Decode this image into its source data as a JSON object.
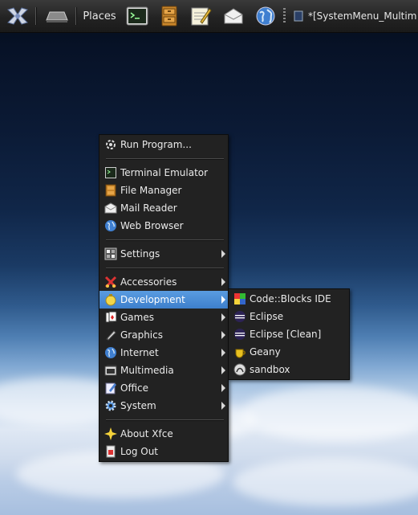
{
  "panel": {
    "places_label": "Places",
    "task_title": "*[SystemMenu_Multim",
    "launchers": [
      {
        "icon": "xfce-logo-icon"
      },
      {
        "icon": "show-desktop-icon"
      },
      {
        "icon": "terminal-icon"
      },
      {
        "icon": "file-manager-icon"
      },
      {
        "icon": "text-editor-icon"
      },
      {
        "icon": "mail-icon"
      },
      {
        "icon": "web-browser-icon"
      }
    ]
  },
  "main_menu": {
    "run_program": "Run Program...",
    "terminal": "Terminal Emulator",
    "file_manager": "File Manager",
    "mail_reader": "Mail Reader",
    "web_browser": "Web Browser",
    "settings": "Settings",
    "accessories": "Accessories",
    "development": "Development",
    "games": "Games",
    "graphics": "Graphics",
    "internet": "Internet",
    "multimedia": "Multimedia",
    "office": "Office",
    "system": "System",
    "about": "About Xfce",
    "logout": "Log Out"
  },
  "dev_submenu": {
    "items": [
      "Code::Blocks IDE",
      "Eclipse",
      "Eclipse [Clean]",
      "Geany",
      "sandbox"
    ]
  },
  "colors": {
    "highlight": "#4a8dd6",
    "menu_bg": "#222222"
  }
}
